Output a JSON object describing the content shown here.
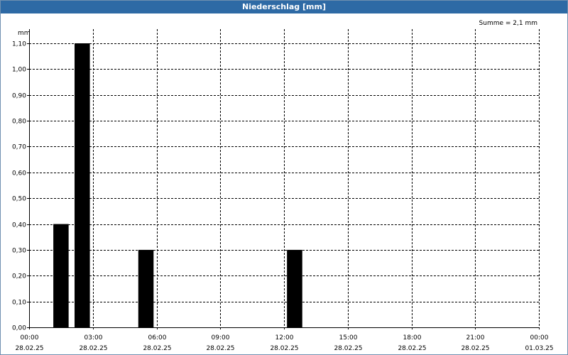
{
  "window": {
    "title": "Niederschlag [mm]"
  },
  "colors": {
    "titlebar": "#2e6aa5",
    "bar": "#000000",
    "grid": "#000000"
  },
  "chart_data": {
    "type": "bar",
    "unit_label": "mm",
    "summary": "Summe = 2,1 mm",
    "grid": true,
    "ylim": [
      0,
      1.1
    ],
    "yticks": [
      "0,00",
      "0,10",
      "0,20",
      "0,30",
      "0,40",
      "0,50",
      "0,60",
      "0,70",
      "0,80",
      "0,90",
      "1,00",
      "1,10"
    ],
    "xticks": [
      {
        "time": "00:00",
        "date": "28.02.25"
      },
      {
        "time": "03:00",
        "date": "28.02.25"
      },
      {
        "time": "06:00",
        "date": "28.02.25"
      },
      {
        "time": "09:00",
        "date": "28.02.25"
      },
      {
        "time": "12:00",
        "date": "28.02.25"
      },
      {
        "time": "15:00",
        "date": "28.02.25"
      },
      {
        "time": "18:00",
        "date": "28.02.25"
      },
      {
        "time": "21:00",
        "date": "28.02.25"
      },
      {
        "time": "00:00",
        "date": "01.03.25"
      }
    ],
    "bars": [
      {
        "start": "28.02.25 01:00",
        "end": "28.02.25 02:00",
        "value": 0.4
      },
      {
        "start": "28.02.25 02:00",
        "end": "28.02.25 03:00",
        "value": 1.1
      },
      {
        "start": "28.02.25 05:00",
        "end": "28.02.25 06:00",
        "value": 0.3
      },
      {
        "start": "28.02.25 12:00",
        "end": "28.02.25 13:00",
        "value": 0.3
      }
    ]
  }
}
